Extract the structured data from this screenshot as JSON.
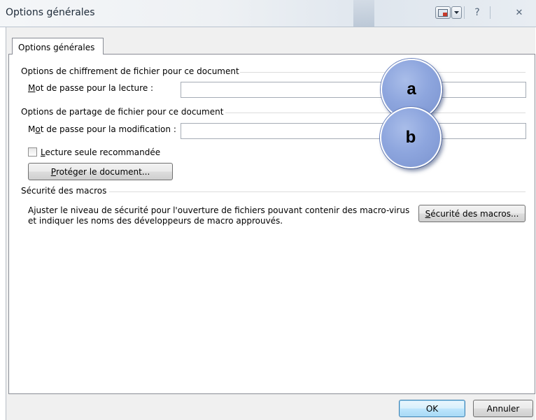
{
  "window": {
    "title": "Options générales",
    "controls": {
      "help": "?",
      "close": "✕"
    }
  },
  "tabs": [
    {
      "label": "Options générales",
      "active": true
    }
  ],
  "encryption": {
    "heading": "Options de chiffrement de fichier pour ce document",
    "password_label_key": "M",
    "password_label_rest": "ot de passe pour la lecture :",
    "password_value": ""
  },
  "sharing": {
    "heading": "Options de partage de fichier pour ce document",
    "password_label_pre": "M",
    "password_label_key": "o",
    "password_label_rest": "t de passe pour la modification :",
    "password_value": "",
    "readonly_key": "L",
    "readonly_rest": "ecture seule recommandée",
    "readonly_checked": false,
    "protect_key": "P",
    "protect_rest": "rotéger le document..."
  },
  "macros": {
    "heading": "Sécurité des macros",
    "description_line1": "Ajuster le niveau de sécurité pour l'ouverture de fichiers pouvant contenir des macro-virus",
    "description_line2": "et indiquer les noms des développeurs de macro approuvés.",
    "button_key": "S",
    "button_rest": "écurité des macros..."
  },
  "annotations": {
    "a": "a",
    "b": "b"
  },
  "footer": {
    "ok": "OK",
    "cancel": "Annuler"
  },
  "colors": {
    "annotation_fill": "#8ea6de",
    "ok_border": "#3c7fb1"
  }
}
